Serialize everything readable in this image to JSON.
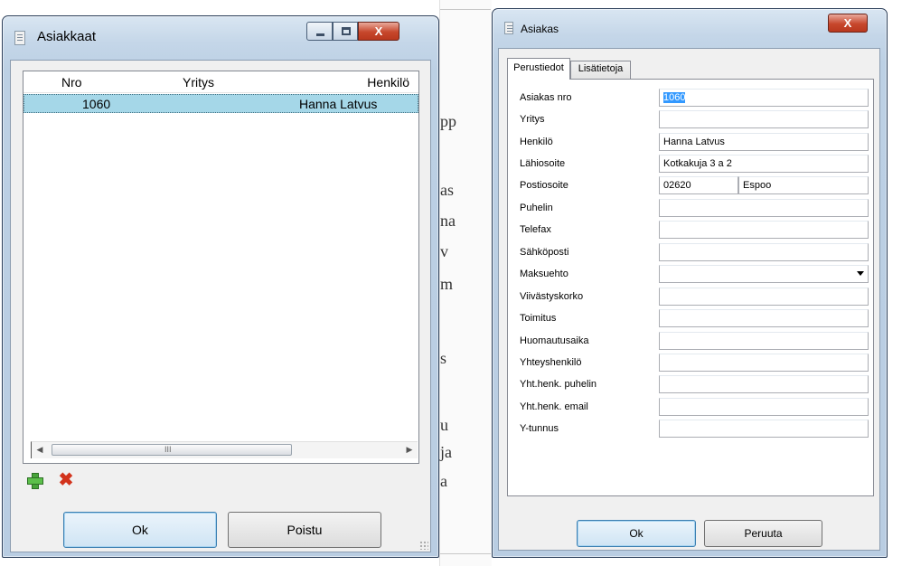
{
  "background": {
    "fragments": [
      "pp",
      "as",
      "na",
      "v",
      "m",
      "s",
      "u",
      "ja",
      "a"
    ]
  },
  "list_window": {
    "title": "Asiakkaat",
    "close_glyph": "X",
    "columns": [
      "Nro",
      "Yritys",
      "Henkilö"
    ],
    "rows": [
      {
        "nro": "1060",
        "yritys": "",
        "henkilo": "Hanna Latvus"
      }
    ],
    "scroll": {
      "left_arrow": "◀",
      "right_arrow": "▶",
      "grip": "III"
    },
    "ok_label": "Ok",
    "delete_label": "Poistu",
    "icons": {
      "add": "add-icon",
      "delete": "delete-icon"
    },
    "colors": {
      "selection": "#a5d7e8"
    }
  },
  "detail_window": {
    "title": "Asiakas",
    "close_glyph": "X",
    "tabs": [
      "Perustiedot",
      "Lisätietoja"
    ],
    "fields": {
      "asiakas_nro": {
        "label": "Asiakas nro",
        "value": "1060"
      },
      "yritys": {
        "label": "Yritys",
        "value": ""
      },
      "henkilo": {
        "label": "Henkilö",
        "value": "Hanna Latvus"
      },
      "lahiosoite": {
        "label": "Lähiosoite",
        "value": "Kotkakuja 3 a 2"
      },
      "postiosoite": {
        "label": "Postiosoite",
        "postal_code": "02620",
        "city": "Espoo"
      },
      "puhelin": {
        "label": "Puhelin",
        "value": ""
      },
      "telefax": {
        "label": "Telefax",
        "value": ""
      },
      "sahkoposti": {
        "label": "Sähköposti",
        "value": ""
      },
      "maksuehto": {
        "label": "Maksuehto",
        "value": ""
      },
      "viivastyskorko": {
        "label": "Viivästyskorko",
        "value": ""
      },
      "toimitus": {
        "label": "Toimitus",
        "value": ""
      },
      "huomautusaika": {
        "label": "Huomautusaika",
        "value": ""
      },
      "yhteyshenkilo": {
        "label": "Yhteyshenkilö",
        "value": ""
      },
      "yht_puhelin": {
        "label": "Yht.henk. puhelin",
        "value": ""
      },
      "yht_email": {
        "label": "Yht.henk. email",
        "value": ""
      },
      "y_tunnus": {
        "label": "Y-tunnus",
        "value": ""
      }
    },
    "ok_label": "Ok",
    "cancel_label": "Peruuta"
  }
}
